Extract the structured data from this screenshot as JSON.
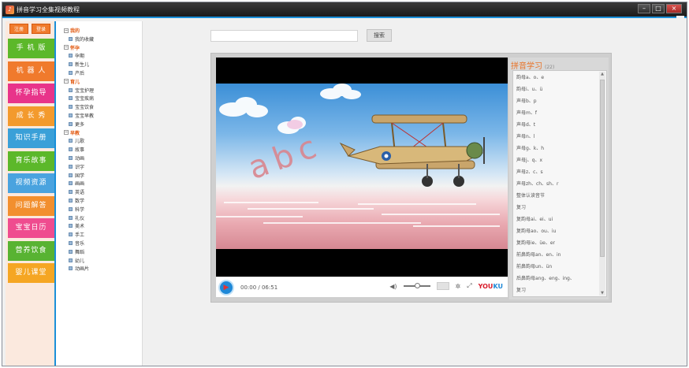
{
  "window": {
    "title": "拼音学习全集视频教程",
    "controls": {
      "minimize": "–",
      "maximize": "□",
      "close": "×"
    }
  },
  "auth": {
    "register": "注册",
    "login": "登录"
  },
  "nav": [
    {
      "label": "手 机 版",
      "color": "#5cb82a"
    },
    {
      "label": "机 器 人",
      "color": "#f07a2c"
    },
    {
      "label": "怀孕指导",
      "color": "#e8348a"
    },
    {
      "label": "成 长 秀",
      "color": "#f39a2d"
    },
    {
      "label": "知识手册",
      "color": "#3aa0d8"
    },
    {
      "label": "育乐故事",
      "color": "#5cb82a"
    },
    {
      "label": "视频资源",
      "color": "#4aa3df"
    },
    {
      "label": "问题解答",
      "color": "#f28f2e"
    },
    {
      "label": "宝宝日历",
      "color": "#ef4c8f"
    },
    {
      "label": "营养饮食",
      "color": "#58b332"
    },
    {
      "label": "婴儿课堂",
      "color": "#f5a623"
    }
  ],
  "tree": [
    {
      "label": "我的",
      "type": "cat"
    },
    {
      "label": "我的收藏",
      "type": "leaf"
    },
    {
      "label": "怀孕",
      "type": "cat"
    },
    {
      "label": "孕期",
      "type": "leaf"
    },
    {
      "label": "新生儿",
      "type": "leaf"
    },
    {
      "label": "产后",
      "type": "leaf"
    },
    {
      "label": "育儿",
      "type": "cat"
    },
    {
      "label": "宝宝护理",
      "type": "leaf"
    },
    {
      "label": "宝宝疾病",
      "type": "leaf"
    },
    {
      "label": "宝宝饮食",
      "type": "leaf"
    },
    {
      "label": "宝宝早教",
      "type": "leaf"
    },
    {
      "label": "更多",
      "type": "leaf"
    },
    {
      "label": "早教",
      "type": "cat"
    },
    {
      "label": "儿歌",
      "type": "leaf"
    },
    {
      "label": "故事",
      "type": "leaf"
    },
    {
      "label": "动画",
      "type": "leaf"
    },
    {
      "label": "识字",
      "type": "leaf"
    },
    {
      "label": "国学",
      "type": "leaf"
    },
    {
      "label": "画画",
      "type": "leaf"
    },
    {
      "label": "英语",
      "type": "leaf"
    },
    {
      "label": "数学",
      "type": "leaf"
    },
    {
      "label": "科学",
      "type": "leaf"
    },
    {
      "label": "礼仪",
      "type": "leaf"
    },
    {
      "label": "美术",
      "type": "leaf"
    },
    {
      "label": "手工",
      "type": "leaf"
    },
    {
      "label": "音乐",
      "type": "leaf"
    },
    {
      "label": "舞蹈",
      "type": "leaf"
    },
    {
      "label": "幼儿",
      "type": "leaf"
    },
    {
      "label": "动画片",
      "type": "leaf"
    }
  ],
  "search": {
    "placeholder": "",
    "button": "搜索"
  },
  "video": {
    "letters": "abc",
    "time": "00:00 / 06:51",
    "brand_main": "YOU",
    "brand_accent": "KU"
  },
  "playlist": {
    "title": "拼音学习",
    "count": "(22)",
    "items": [
      "韵母a、o、e",
      "韵母i、u、ü",
      "声母b、p",
      "声母m、f",
      "声母d、t",
      "声母n、l",
      "声母g、k、h",
      "声母j、q、x",
      "声母z、c、s",
      "声母zh、ch、sh、r",
      "整体认读音节",
      "复习",
      "复韵母ai、ei、ui",
      "复韵母ao、ou、iu",
      "复韵母ie、üe、er",
      "前鼻韵母an、en、in",
      "前鼻韵母un、ün",
      "后鼻韵母ang、eng、ing、",
      "复习"
    ]
  },
  "colors": {
    "accent": "#1a8fd8",
    "orange": "#e8742a"
  }
}
